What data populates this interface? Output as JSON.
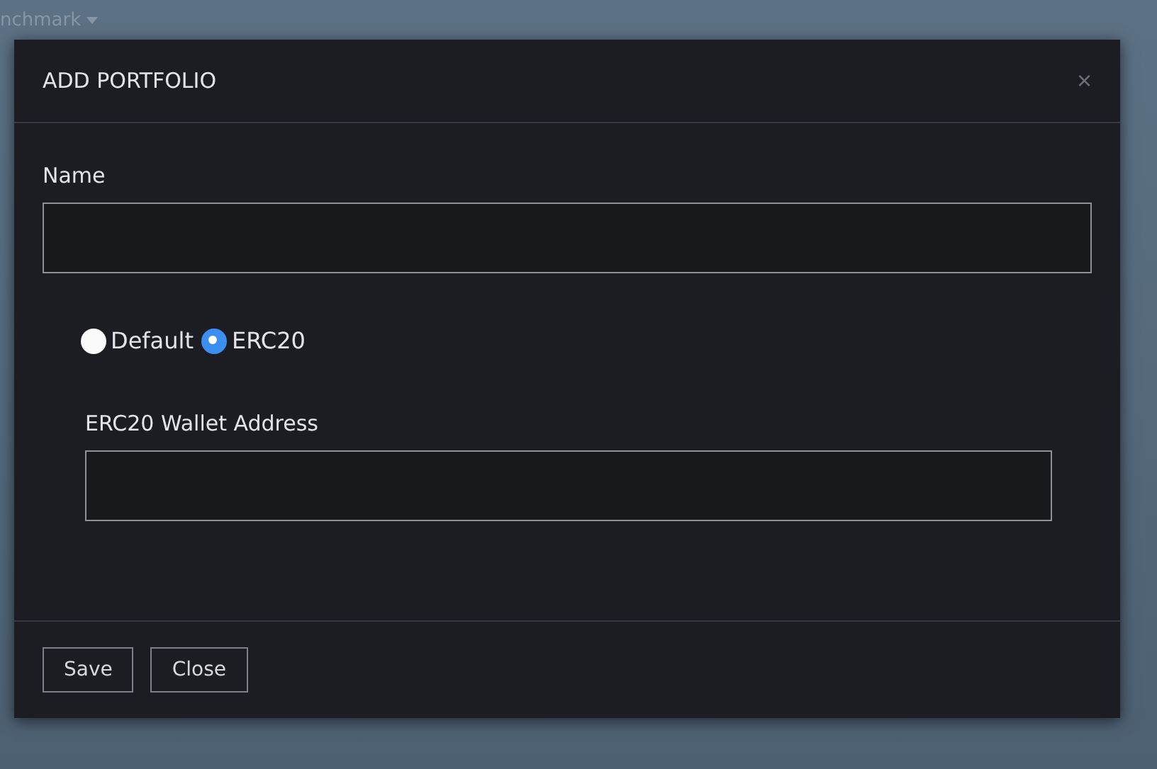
{
  "background": {
    "menu_label": "nchmark"
  },
  "dialog": {
    "title": "ADD PORTFOLIO",
    "close": "×",
    "name_field": {
      "label": "Name"
    },
    "options": [
      {
        "label": "Default",
        "selected": false
      },
      {
        "label": "ERC20",
        "selected": true
      }
    ],
    "wallet_field": {
      "label": "ERC20 Wallet Address"
    },
    "buttons": [
      "Save",
      "Close"
    ]
  }
}
